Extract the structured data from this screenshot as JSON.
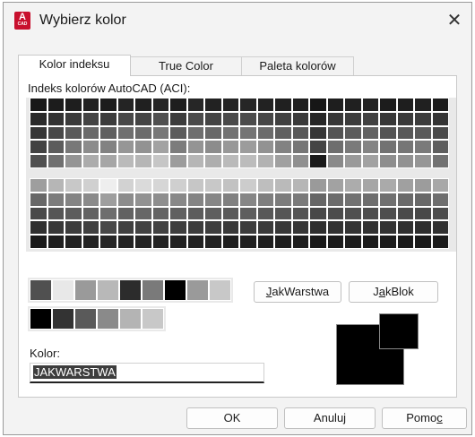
{
  "window": {
    "title": "Wybierz kolor",
    "app_icon_letter": "A",
    "app_icon_sub": "CAD",
    "close_glyph": "✕"
  },
  "tabs": [
    {
      "label": "Kolor indeksu",
      "active": true
    },
    {
      "label": "True Color",
      "active": false
    },
    {
      "label": "Paleta kolorów",
      "active": false
    }
  ],
  "aci": {
    "section_label": "Indeks kolorów AutoCAD (ACI):",
    "top_grid": [
      [
        "#181818",
        "#1c1c1c",
        "#1e1e1e",
        "#222222",
        "#1c1c1c",
        "#242424",
        "#202020",
        "#262626",
        "#1e1e1e",
        "#262626",
        "#222222",
        "#242424",
        "#262626",
        "#222222",
        "#202020",
        "#1e1e1e",
        "#161616",
        "#1e1e1e",
        "#202020",
        "#222222",
        "#1c1c1c",
        "#1e1e1e",
        "#202020",
        "#1c1c1c"
      ],
      [
        "#2a2a2a",
        "#323232",
        "#3a3a3a",
        "#444444",
        "#3c3c3c",
        "#484848",
        "#444444",
        "#505050",
        "#3c3c3c",
        "#4a4a4a",
        "#444444",
        "#4a4a4a",
        "#4c4c4c",
        "#464646",
        "#404040",
        "#3a3a3a",
        "#262626",
        "#383838",
        "#3c3c3c",
        "#404040",
        "#383838",
        "#3a3a3a",
        "#3c3c3c",
        "#343434"
      ],
      [
        "#363636",
        "#484848",
        "#5a5a5a",
        "#6a6a6a",
        "#606060",
        "#707070",
        "#6c6c6c",
        "#787878",
        "#5c5c5c",
        "#6e6e6e",
        "#686868",
        "#727272",
        "#747474",
        "#6c6c6c",
        "#606060",
        "#585858",
        "#363636",
        "#545454",
        "#5c5c5c",
        "#626262",
        "#545454",
        "#585858",
        "#5a5a5a",
        "#4a4a4a"
      ],
      [
        "#424242",
        "#5c5c5c",
        "#787878",
        "#8c8c8c",
        "#828282",
        "#969696",
        "#929292",
        "#a2a2a2",
        "#7c7c7c",
        "#949494",
        "#8c8c8c",
        "#989898",
        "#9c9c9c",
        "#929292",
        "#828282",
        "#767676",
        "#444444",
        "#6e6e6e",
        "#7a7a7a",
        "#848484",
        "#727272",
        "#767676",
        "#7a7a7a",
        "#5e5e5e"
      ],
      [
        "#505050",
        "#707070",
        "#949494",
        "#acacac",
        "#a6a6a6",
        "#bababa",
        "#b6b6b6",
        "#c6c6c6",
        "#9c9c9c",
        "#b6b6b6",
        "#aeaeae",
        "#bababa",
        "#bcbcbc",
        "#b2b2b2",
        "#a0a0a0",
        "#909090",
        "#1a1a1a",
        "#8a8a8a",
        "#9a9a9a",
        "#a2a2a2",
        "#8e8e8e",
        "#929292",
        "#969696",
        "#727272"
      ]
    ],
    "bottom_grid": [
      [
        "#9e9e9e",
        "#b6b6b6",
        "#c8c8c8",
        "#d0d0d0",
        "#eeeeee",
        "#d2d2d2",
        "#dadada",
        "#d6d6d6",
        "#cfcfcf",
        "#c6c6c6",
        "#c8c8c8",
        "#c2c2c2",
        "#cccccc",
        "#bebebe",
        "#bababa",
        "#b6b6b6",
        "#9a9a9a",
        "#a2a2a2",
        "#acacac",
        "#a6a6a6",
        "#aaaaaa",
        "#a0a0a0",
        "#9c9c9c",
        "#a8a8a8"
      ],
      [
        "#686868",
        "#7c7c7c",
        "#848484",
        "#8a8a8a",
        "#9e9e9e",
        "#8c8c8c",
        "#929292",
        "#8e8e8e",
        "#888888",
        "#848484",
        "#868686",
        "#808080",
        "#868686",
        "#7e7e7e",
        "#7c7c7c",
        "#7a7a7a",
        "#666666",
        "#6c6c6c",
        "#727272",
        "#6e6e6e",
        "#707070",
        "#6a6a6a",
        "#686868",
        "#6e6e6e"
      ],
      [
        "#4a4a4a",
        "#565656",
        "#5c5c5c",
        "#626262",
        "#6e6e6e",
        "#626262",
        "#666666",
        "#646464",
        "#606060",
        "#5c5c5c",
        "#5e5e5e",
        "#5a5a5a",
        "#5e5e5e",
        "#585858",
        "#565656",
        "#545454",
        "#484848",
        "#4c4c4c",
        "#505050",
        "#4e4e4e",
        "#4e4e4e",
        "#4a4a4a",
        "#484848",
        "#4c4c4c"
      ],
      [
        "#303030",
        "#383838",
        "#3c3c3c",
        "#404040",
        "#484848",
        "#404040",
        "#424242",
        "#424242",
        "#3e3e3e",
        "#3c3c3c",
        "#3e3e3e",
        "#3a3a3a",
        "#3c3c3c",
        "#3a3a3a",
        "#383838",
        "#363636",
        "#2e2e2e",
        "#323232",
        "#343434",
        "#323232",
        "#333333",
        "#303030",
        "#2e2e2e",
        "#313131"
      ],
      [
        "#1a1a1a",
        "#1e1e1e",
        "#202020",
        "#222222",
        "#262626",
        "#222222",
        "#232323",
        "#232323",
        "#212121",
        "#202020",
        "#212121",
        "#1f1f1f",
        "#202020",
        "#1f1f1f",
        "#1e1e1e",
        "#1d1d1d",
        "#191919",
        "#1b1b1b",
        "#1c1c1c",
        "#1b1b1b",
        "#1c1c1c",
        "#1a1a1a",
        "#191919",
        "#1b1b1b"
      ]
    ],
    "standard_colors": [
      "#505050",
      "#e8e8e8",
      "#9a9a9a",
      "#b8b8b8",
      "#2c2c2c",
      "#7a7a7a",
      "#000000",
      "#9a9a9a",
      "#c8c8c8"
    ],
    "gray_colors": [
      "#000000",
      "#333333",
      "#5a5a5a",
      "#8a8a8a",
      "#b4b4b4",
      "#c8c8c8"
    ]
  },
  "buttons": {
    "jak_warstwa_pre": "",
    "jak_warstwa_ul": "J",
    "jak_warstwa_post": "akWarstwa",
    "jak_blok_pre": "J",
    "jak_blok_ul": "a",
    "jak_blok_post": "kBlok",
    "ok": "OK",
    "cancel": "Anuluj",
    "help_pre": "Pomo",
    "help_ul": "c"
  },
  "color_field": {
    "label": "Kolor:",
    "value": "JAKWARSTWA"
  },
  "preview": {
    "old_color": "#000000",
    "new_color": "#000000"
  }
}
